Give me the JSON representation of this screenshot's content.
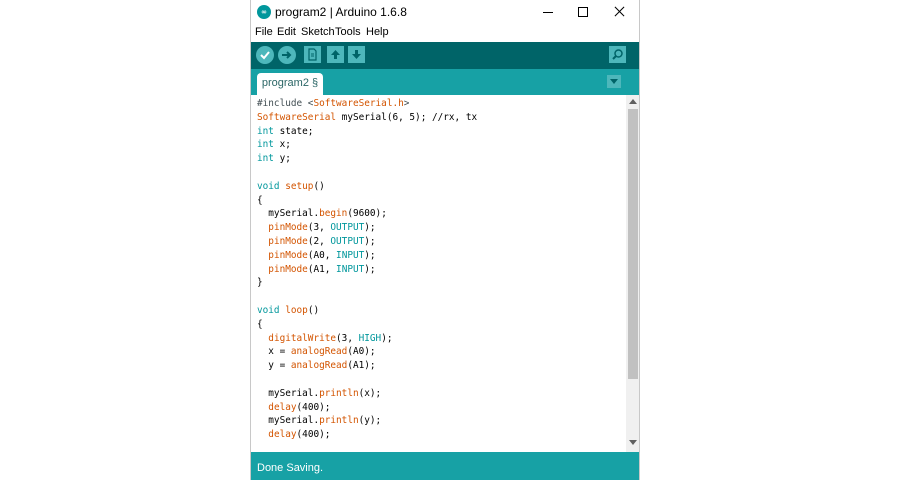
{
  "window": {
    "title": "program2 | Arduino 1.6.8",
    "app_icon_glyph": "∞"
  },
  "menu": [
    "File",
    "Edit",
    "Sketch",
    "Tools",
    "Help"
  ],
  "toolbar": {
    "buttons": [
      "verify-icon",
      "upload-icon",
      "new-icon",
      "open-icon",
      "save-icon"
    ],
    "serial_monitor": "magnifier-icon"
  },
  "tabs": [
    {
      "label": "program2 §"
    }
  ],
  "code": [
    [
      [
        "#include <",
        "cm"
      ],
      [
        "SoftwareSerial.h",
        "fn"
      ],
      [
        ">",
        "cm"
      ]
    ],
    [
      [
        "SoftwareSerial",
        "fn"
      ],
      [
        " mySerial(6, 5); //rx, tx",
        ""
      ]
    ],
    [
      [
        "int",
        "ty"
      ],
      [
        " state;",
        ""
      ]
    ],
    [
      [
        "int",
        "ty"
      ],
      [
        " x;",
        ""
      ]
    ],
    [
      [
        "int",
        "ty"
      ],
      [
        " y;",
        ""
      ]
    ],
    [],
    [
      [
        "void",
        "ty"
      ],
      [
        " ",
        ""
      ],
      [
        "setup",
        "fn"
      ],
      [
        "()",
        ""
      ]
    ],
    [
      [
        "{",
        ""
      ]
    ],
    [
      [
        "  mySerial.",
        ""
      ],
      [
        "begin",
        "fn"
      ],
      [
        "(9600);",
        ""
      ]
    ],
    [
      [
        "  ",
        ""
      ],
      [
        "pinMode",
        "fn"
      ],
      [
        "(3, ",
        ""
      ],
      [
        "OUTPUT",
        "cn"
      ],
      [
        ");",
        ""
      ]
    ],
    [
      [
        "  ",
        ""
      ],
      [
        "pinMode",
        "fn"
      ],
      [
        "(2, ",
        ""
      ],
      [
        "OUTPUT",
        "cn"
      ],
      [
        ");",
        ""
      ]
    ],
    [
      [
        "  ",
        ""
      ],
      [
        "pinMode",
        "fn"
      ],
      [
        "(A0, ",
        ""
      ],
      [
        "INPUT",
        "cn"
      ],
      [
        ");",
        ""
      ]
    ],
    [
      [
        "  ",
        ""
      ],
      [
        "pinMode",
        "fn"
      ],
      [
        "(A1, ",
        ""
      ],
      [
        "INPUT",
        "cn"
      ],
      [
        ");",
        ""
      ]
    ],
    [
      [
        "}",
        ""
      ]
    ],
    [],
    [
      [
        "void",
        "ty"
      ],
      [
        " ",
        ""
      ],
      [
        "loop",
        "fn"
      ],
      [
        "()",
        ""
      ]
    ],
    [
      [
        "{",
        ""
      ]
    ],
    [
      [
        "  ",
        ""
      ],
      [
        "digitalWrite",
        "fn"
      ],
      [
        "(3, ",
        ""
      ],
      [
        "HIGH",
        "cn"
      ],
      [
        ");",
        ""
      ]
    ],
    [
      [
        "  x = ",
        ""
      ],
      [
        "analogRead",
        "fn"
      ],
      [
        "(A0);",
        ""
      ]
    ],
    [
      [
        "  y = ",
        ""
      ],
      [
        "analogRead",
        "fn"
      ],
      [
        "(A1);",
        ""
      ]
    ],
    [],
    [
      [
        "  mySerial.",
        ""
      ],
      [
        "println",
        "fn"
      ],
      [
        "(x);",
        ""
      ]
    ],
    [
      [
        "  ",
        ""
      ],
      [
        "delay",
        "fn"
      ],
      [
        "(400);",
        ""
      ]
    ],
    [
      [
        "  mySerial.",
        ""
      ],
      [
        "println",
        "fn"
      ],
      [
        "(y);",
        ""
      ]
    ],
    [
      [
        "  ",
        ""
      ],
      [
        "delay",
        "fn"
      ],
      [
        "(400);",
        ""
      ]
    ]
  ],
  "status": "Done Saving.",
  "colors": {
    "toolbar": "#006468",
    "tabbar": "#17a1a5",
    "button": "#4db7bb",
    "keyword": "#00979c",
    "function": "#d35400",
    "status_bar": "#17a1a5"
  }
}
